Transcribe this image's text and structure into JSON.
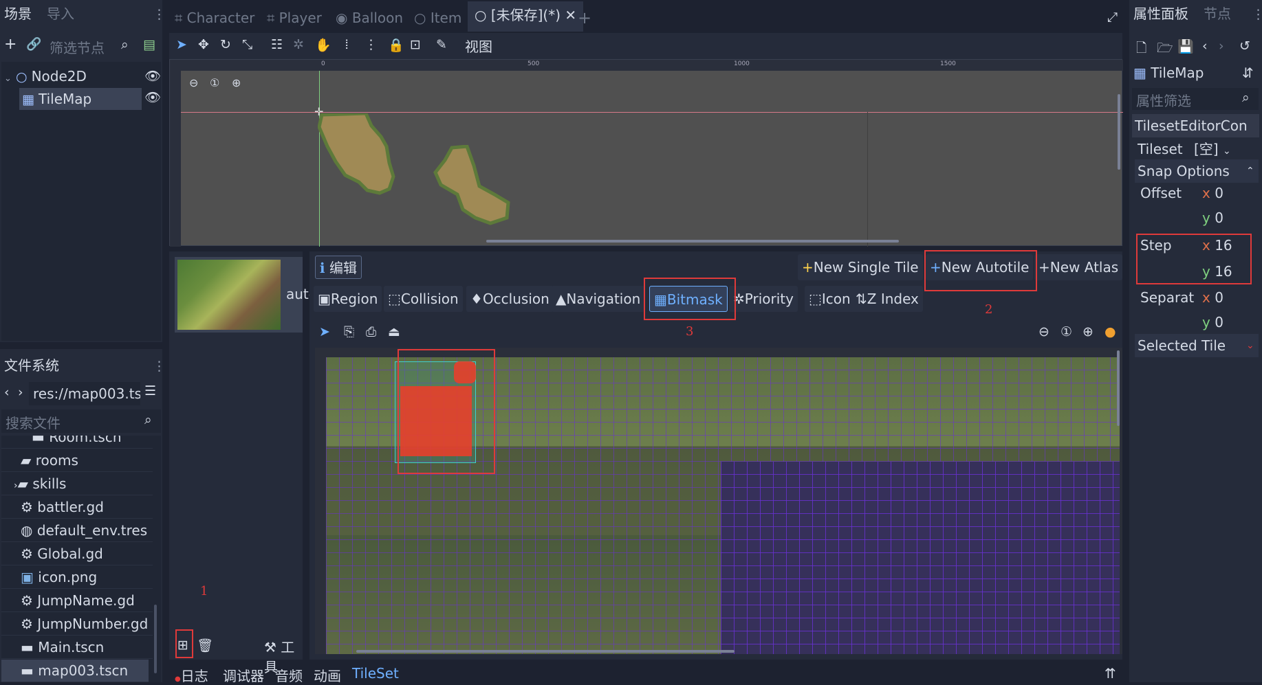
{
  "scene_panel": {
    "tabs": [
      "场景",
      "导入"
    ],
    "filter_placeholder": "筛选节点",
    "tree": [
      {
        "label": "Node2D"
      },
      {
        "label": "TileMap"
      }
    ]
  },
  "filesystem": {
    "tab": "文件系统",
    "path": "res://map003.ts",
    "search_placeholder": "搜索文件",
    "items": [
      {
        "label": "Room.tscn"
      },
      {
        "label": "rooms"
      },
      {
        "label": "skills"
      },
      {
        "label": "battler.gd"
      },
      {
        "label": "default_env.tres"
      },
      {
        "label": "Global.gd"
      },
      {
        "label": "icon.png"
      },
      {
        "label": "JumpName.gd"
      },
      {
        "label": "JumpNumber.gd"
      },
      {
        "label": "Main.tscn"
      },
      {
        "label": "map003.tscn"
      }
    ]
  },
  "editor_tabs": [
    "Character",
    "Player",
    "Balloon",
    "Item",
    "[未保存](*)"
  ],
  "toolbar": {
    "view_label": "视图"
  },
  "ruler": {
    "marks": [
      "0",
      "500",
      "1000",
      "1500"
    ]
  },
  "tileset_panel": {
    "texture_label": "auto",
    "edit_tab": "编辑",
    "new_single_tile": "New Single Tile",
    "new_autotile": "New Autotile",
    "new_atlas": "New Atlas",
    "modes": [
      "Region",
      "Collision",
      "Occlusion",
      "Navigation",
      "Bitmask",
      "Priority",
      "Icon",
      "Z Index"
    ],
    "tools_label": "工具"
  },
  "bottom_tabs": [
    "日志",
    "调试器",
    "音频",
    "动画",
    "TileSet"
  ],
  "inspector": {
    "tabs": [
      "属性面板",
      "节点"
    ],
    "node_name": "TileMap",
    "filter_placeholder": "属性筛选",
    "class_name": "TilesetEditorCon",
    "tileset_label": "Tileset",
    "tileset_value": "[空]",
    "snap_options": "Snap Options",
    "offset_label": "Offset",
    "offset_x": "0",
    "offset_y": "0",
    "step_label": "Step",
    "step_x": "16",
    "step_y": "16",
    "separation_label": "Separat",
    "separation_x": "0",
    "separation_y": "0",
    "selected_tile": "Selected Tile"
  },
  "annotations": [
    "1",
    "2",
    "3"
  ],
  "axis_x": "x",
  "axis_y": "y",
  "colors": {
    "accent": "#6fb0ff",
    "highlight": "#e03a3a",
    "grid": "#6a2fd6"
  }
}
